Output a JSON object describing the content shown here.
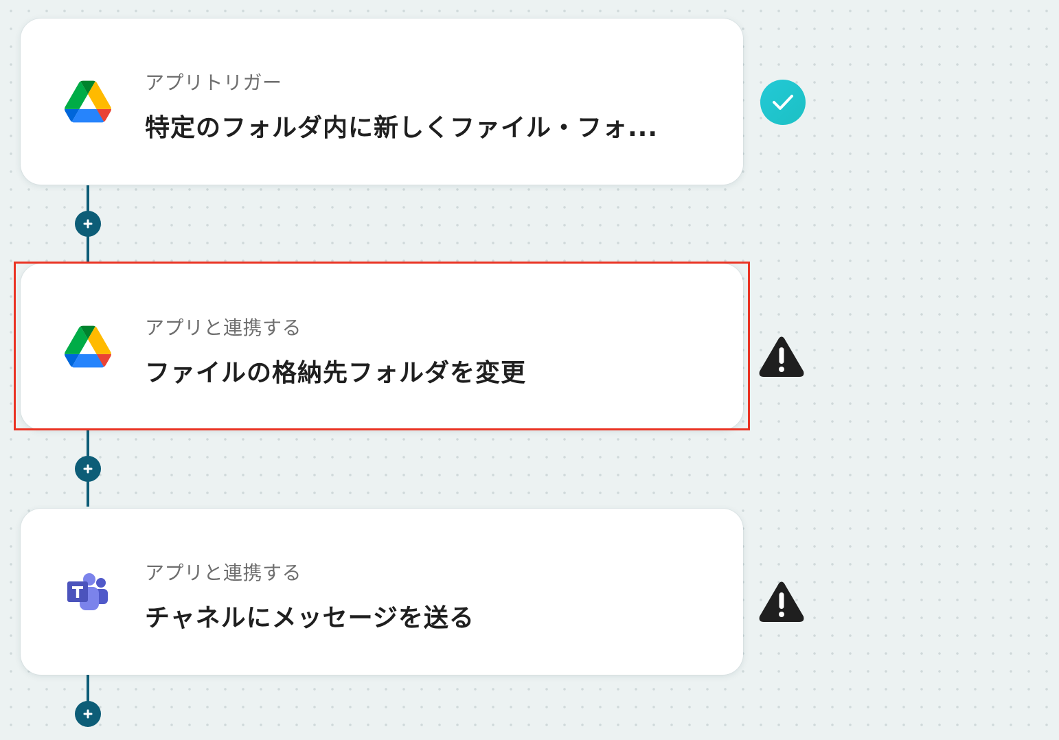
{
  "steps": [
    {
      "app_icon": "google-drive-icon",
      "type_label": "アプリトリガー",
      "title": "特定のフォルダ内に新しくファイル・フォ...",
      "status": "check-icon"
    },
    {
      "app_icon": "google-drive-icon",
      "type_label": "アプリと連携する",
      "title": "ファイルの格納先フォルダを変更",
      "status": "warning-icon",
      "highlighted": true
    },
    {
      "app_icon": "microsoft-teams-icon",
      "type_label": "アプリと連携する",
      "title": "チャネルにメッセージを送る",
      "status": "warning-icon"
    }
  ],
  "colors": {
    "connector": "#0d5d77",
    "check": "#23c9d6",
    "highlight": "#ea3323",
    "warning": "#1f1f1f"
  }
}
